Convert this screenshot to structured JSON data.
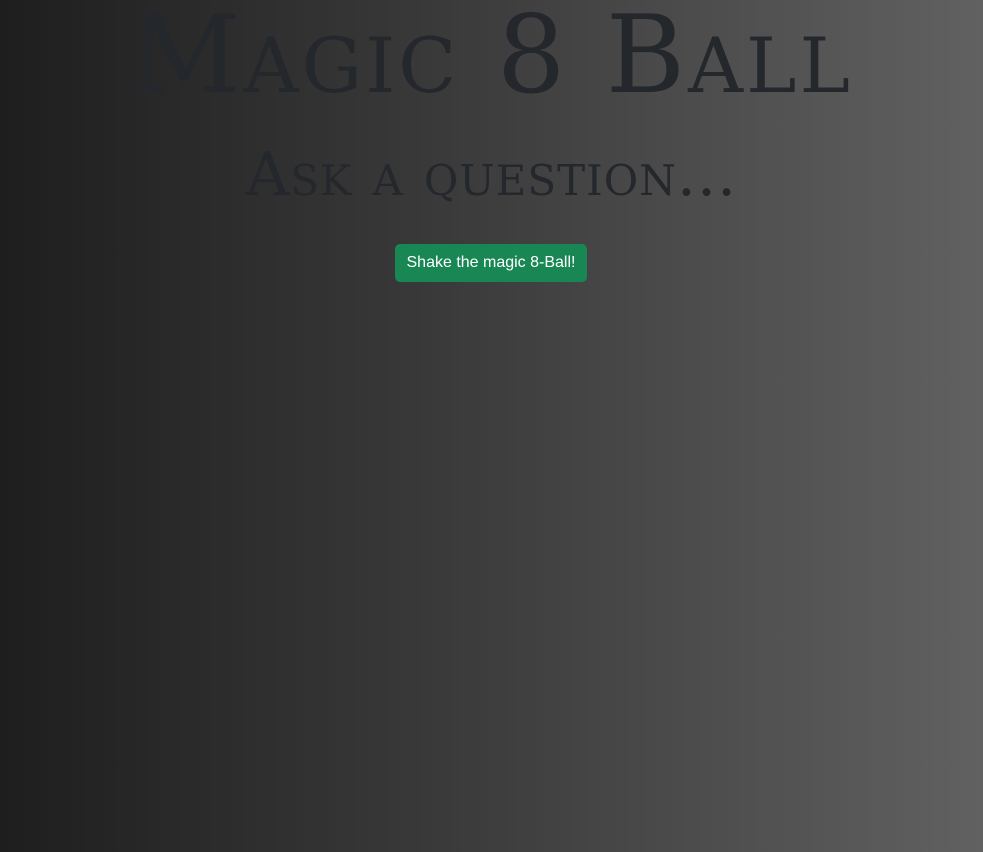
{
  "header": {
    "title": "Magic 8 Ball",
    "subtitle": "Ask a question..."
  },
  "actions": {
    "shake_label": "Shake the magic 8-Ball!"
  },
  "colors": {
    "button_bg": "#198754",
    "button_text": "#ffffff",
    "heading_text": "#24272b",
    "background_left": "#1e1e1e",
    "background_right": "#616161"
  }
}
